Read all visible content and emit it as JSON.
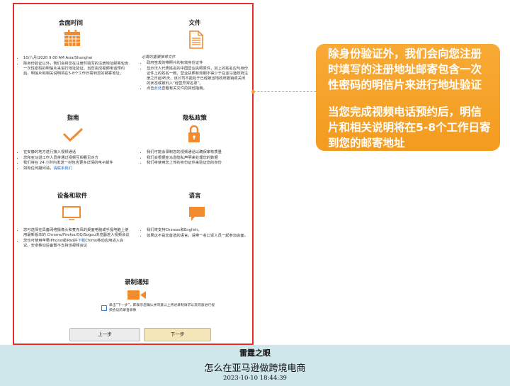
{
  "panel": {
    "meeting_time": {
      "title": "会面时间",
      "icon": "calendar-icon",
      "bullets": [
        "10/八月/2020 9:00 AM Asia/Shanghai",
        "除身份验证以外，我们会将您在注册时填写的注册地址邮寄包含一次性密码的明信片来进行地址验证。当您完成视频电话预约后，明信片和相关说明将在5-8个工作日寄到您的邮寄地址。"
      ]
    },
    "documents": {
      "title": "文件",
      "icon": "document-icon",
      "subtitle": "必需的重要推荐文件",
      "bullets": [
        "政府签发的带照片的有效身份证件",
        "显示法人代表姓名的中国营业执照原件，其上的姓名应与身份证件上的姓名一致。营业执照有效期不得少于在亚马逊政府注册之日起45天。该公司不能处于已经被当地政府撤销或关闭的状态或被列入“经营异常名录”。"
      ],
      "link_prefix": "点击",
      "link_text": "此处",
      "link_suffix": "查看有关文件的其他指南。"
    },
    "guide": {
      "title": "指南",
      "icon": "checkmark-icon",
      "bullets": [
        "在安静的地方进行接入视频通话",
        "您和亚马逊工作人员将通过视频互相看见对方",
        "我们将在 24 小时内发送一封包含更多详情的电子邮件"
      ],
      "contact_prefix": "如有任何疑问请，",
      "contact_link": "请联系我们"
    },
    "privacy": {
      "title": "隐私政策",
      "icon": "lock-icon",
      "bullets": [
        "我们可能会录制您的视频通话以确保审核质量",
        "我们会根据亚马逊隐私声明来处理您的数据",
        "我们将使用您上传的身份证件来验证您的身份"
      ]
    },
    "devices": {
      "title": "设备和软件",
      "icon": "monitor-icon",
      "bullets": [
        "您可选择在具备网络摄像头和麦克风的桌面电脑或手提电脑上使用最新版本的 Chrome/Firefox/QQ/Sogou浏览器进入视频会议"
      ],
      "app_prefix": "您也可使用苹果iPhone或iPad并",
      "app_link": "下载",
      "app_suffix": "Chime移动应用进入会议。安卓移动设备暂不支持该视频会议"
    },
    "language": {
      "title": "语言",
      "icon": "chat-icon",
      "bullets": [
        "我们将支持Chinese和English。",
        "如果这不是您首选的语言，请带一名口译人员一起参加会面。"
      ]
    },
    "recording": {
      "title": "录制通知",
      "icon": "video-camera-icon",
      "consent_text": "单击“下一步”，即表示您确认并同意以上所述录制请求以及同意进行视频会议的录音录像",
      "consent_checked": false
    },
    "buttons": {
      "prev": "上一步",
      "next": "下一步"
    }
  },
  "callout": {
    "paragraphs": [
      "除身份验证外，我们会向您注册时填写的注册地址邮寄包含一次性密码的明信片来进行地址验证",
      "当您完成视频电话预约后，明信片和相关说明将在5-8个工作日寄到您的邮寄地址"
    ]
  },
  "footer": {
    "line1": "雷霆之眼",
    "line2": "怎么在亚马逊做跨境电商",
    "line3": "2023-10-10 18:44:39"
  },
  "colors": {
    "panel_border": "#e3302b",
    "icon_accent": "#f28a2e",
    "callout_bg": "#f6a02a",
    "link": "#1a66c4",
    "next_button": "#f4e6b8",
    "footer_bg": "#cfe6eb"
  }
}
